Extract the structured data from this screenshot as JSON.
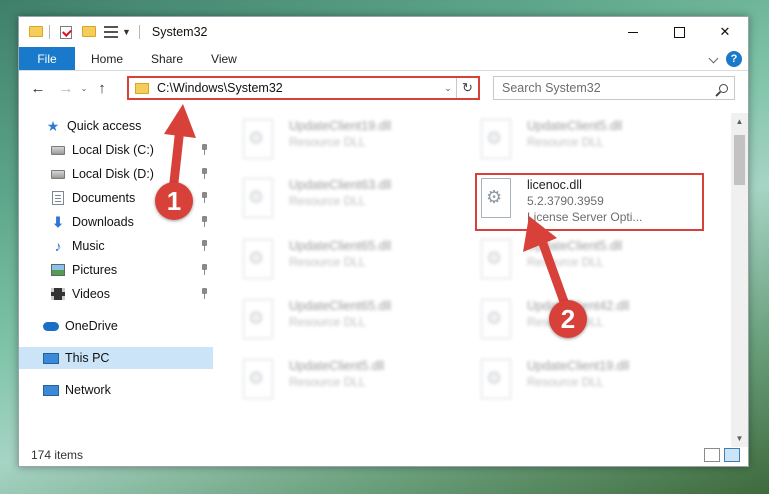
{
  "window": {
    "title": "System32",
    "minimize_icon": "minimize-icon",
    "maximize_icon": "maximize-icon",
    "close_label": "✕"
  },
  "ribbon": {
    "tabs": [
      "File",
      "Home",
      "Share",
      "View"
    ],
    "help_label": "?"
  },
  "nav": {
    "back": "←",
    "forward": "→",
    "recent": "⌄",
    "up": "↑",
    "address": "C:\\Windows\\System32",
    "address_dropdown": "⌄",
    "refresh": "↻",
    "search_placeholder": "Search System32"
  },
  "sidebar": {
    "items": [
      {
        "label": "Quick access",
        "icon": "star-icon"
      },
      {
        "label": "Local Disk (C:)",
        "icon": "disk-icon",
        "pinned": true
      },
      {
        "label": "Local Disk (D:)",
        "icon": "disk-icon",
        "pinned": true
      },
      {
        "label": "Documents",
        "icon": "documents-icon",
        "pinned": true
      },
      {
        "label": "Downloads",
        "icon": "downloads-icon",
        "pinned": true
      },
      {
        "label": "Music",
        "icon": "music-icon",
        "pinned": true
      },
      {
        "label": "Pictures",
        "icon": "pictures-icon",
        "pinned": true
      },
      {
        "label": "Videos",
        "icon": "videos-icon",
        "pinned": true
      },
      {
        "label": "OneDrive",
        "icon": "onedrive-icon"
      },
      {
        "label": "This PC",
        "icon": "this-pc-icon",
        "selected": true
      },
      {
        "label": "Network",
        "icon": "network-icon"
      }
    ]
  },
  "files": [
    {
      "name": "UpdateClient19.dll",
      "line2": "Resource DLL",
      "line3": ""
    },
    {
      "name": "UpdateClient5.dll",
      "line2": "Resource DLL",
      "line3": ""
    },
    {
      "name": "UpdateClient63.dll",
      "line2": "Resource DLL",
      "line3": ""
    },
    {
      "name": "licenoc.dll",
      "line2": "5.2.3790.3959",
      "line3": "License Server Opti...",
      "highlighted": true
    },
    {
      "name": "UpdateClient65.dll",
      "line2": "Resource DLL",
      "line3": ""
    },
    {
      "name": "UpdateClient5.dll",
      "line2": "Resource DLL",
      "line3": ""
    },
    {
      "name": "UpdateClient65.dll",
      "line2": "Resource DLL",
      "line3": ""
    },
    {
      "name": "UpdateClient42.dll",
      "line2": "Resource DLL",
      "line3": ""
    },
    {
      "name": "UpdateClient5.dll",
      "line2": "Resource DLL",
      "line3": ""
    },
    {
      "name": "UpdateClient19.dll",
      "line2": "Resource DLL",
      "line3": ""
    }
  ],
  "status": {
    "item_count": "174 items"
  },
  "callouts": [
    "1",
    "2"
  ],
  "colors": {
    "accent": "#1979ca",
    "highlight_red": "#d8413a",
    "selection": "#cce4f7"
  }
}
